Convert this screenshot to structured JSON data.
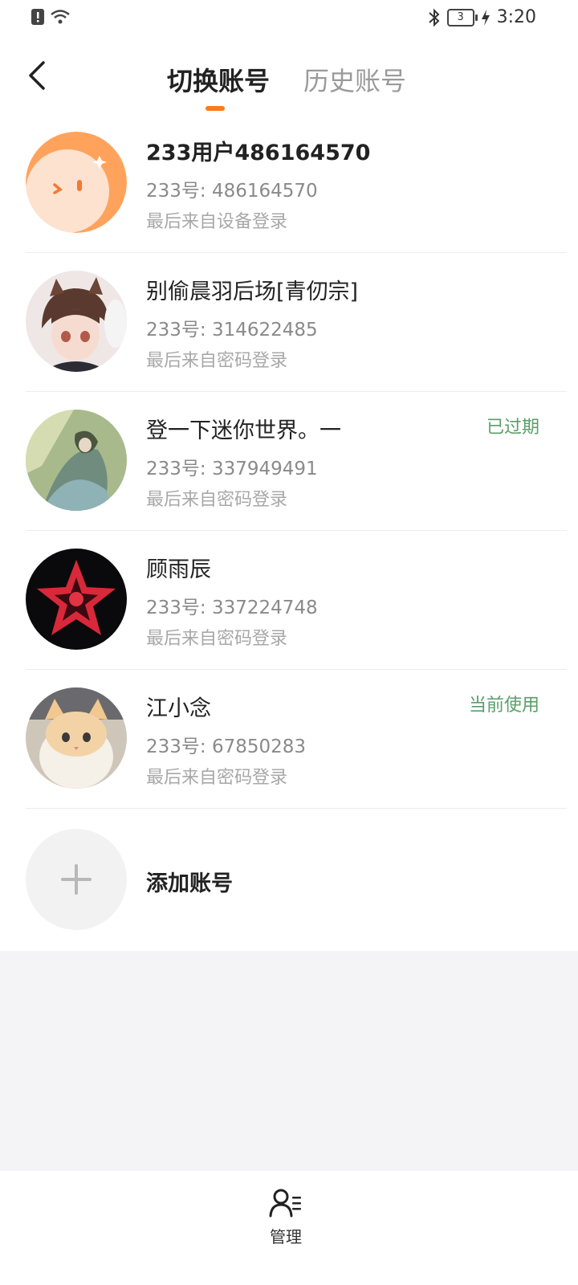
{
  "status_bar": {
    "time": "3:20",
    "battery": "3"
  },
  "header": {
    "tabs": [
      {
        "label": "切换账号",
        "active": true
      },
      {
        "label": "历史账号",
        "active": false
      }
    ],
    "accent_color": "#ff7a1a"
  },
  "accounts": [
    {
      "name": "233用户486164570",
      "uid": "233号: 486164570",
      "last_login": "最后来自设备登录",
      "badge": "",
      "avatar": "orange-face-avatar"
    },
    {
      "name": "别偷晨羽后场[青仞宗]",
      "uid": "233号: 314622485",
      "last_login": "最后来自密码登录",
      "badge": "",
      "avatar": "anime-boy-avatar"
    },
    {
      "name": "登一下迷你世界。一",
      "uid": "233号: 337949491",
      "last_login": "最后来自密码登录",
      "badge": "已过期",
      "avatar": "forest-girl-avatar"
    },
    {
      "name": "顾雨辰",
      "uid": "233号: 337224748",
      "last_login": "最后来自密码登录",
      "badge": "",
      "avatar": "red-star-avatar"
    },
    {
      "name": "江小念",
      "uid": "233号: 67850283",
      "last_login": "最后来自密码登录",
      "badge": "当前使用",
      "avatar": "cat-avatar"
    }
  ],
  "add_account": {
    "label": "添加账号"
  },
  "bottom_bar": {
    "manage_label": "管理"
  },
  "colors": {
    "badge_green": "#5a9e6a"
  }
}
